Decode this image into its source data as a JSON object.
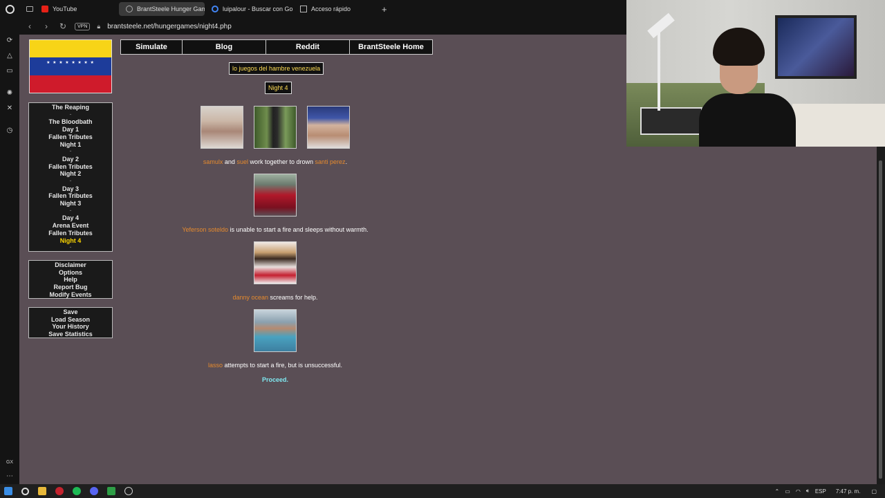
{
  "browser": {
    "tabs": [
      {
        "label": "YouTube",
        "icon": "youtube-icon"
      },
      {
        "label": "BrantSteele Hunger Gam",
        "icon": "site-icon"
      },
      {
        "label": "luipalour - Buscar con Go",
        "icon": "google-icon"
      },
      {
        "label": "Acceso rápido",
        "icon": "speed-dial-icon"
      }
    ],
    "vpn_label": "VPN",
    "url": "brantsteele.net/hungergames/night4.php"
  },
  "nav": [
    "Simulate",
    "Blog",
    "Reddit",
    "BrantSteele Home"
  ],
  "sidebar": {
    "progress": [
      {
        "label": "The Reaping"
      },
      {
        "label": "-"
      },
      {
        "label": "The Bloodbath"
      },
      {
        "label": "Day 1"
      },
      {
        "label": "Fallen Tributes"
      },
      {
        "label": "Night 1"
      },
      {
        "label": "-"
      },
      {
        "label": "Day 2"
      },
      {
        "label": "Fallen Tributes"
      },
      {
        "label": "Night 2"
      },
      {
        "label": "-"
      },
      {
        "label": "Day 3"
      },
      {
        "label": "Fallen Tributes"
      },
      {
        "label": "Night 3"
      },
      {
        "label": "-"
      },
      {
        "label": "Day 4"
      },
      {
        "label": "Arena Event"
      },
      {
        "label": "Fallen Tributes"
      },
      {
        "label": "Night 4",
        "current": true
      },
      {
        "label": "-"
      }
    ],
    "tools": [
      "Disclaimer",
      "Options",
      "Help",
      "Report Bug",
      "Modify Events"
    ],
    "save": [
      "Save",
      "Load Season",
      "Your History",
      "Save Statistics"
    ]
  },
  "season_title": "lo juegos del hambre venezuela",
  "phase_title": "Night 4",
  "events": [
    {
      "parts": [
        {
          "t": "samulx",
          "n": true
        },
        {
          "t": " and "
        },
        {
          "t": "suel",
          "n": true
        },
        {
          "t": " work together to drown "
        },
        {
          "t": "santi perez",
          "n": true
        },
        {
          "t": "."
        }
      ]
    },
    {
      "parts": [
        {
          "t": "Yeferson soteldo",
          "n": true
        },
        {
          "t": " is unable to start a fire and sleeps without warmth."
        }
      ]
    },
    {
      "parts": [
        {
          "t": "danny ocean",
          "n": true
        },
        {
          "t": " screams for help."
        }
      ]
    },
    {
      "parts": [
        {
          "t": "lasso",
          "n": true
        },
        {
          "t": " attempts to start a fire, but is unsuccessful."
        }
      ]
    }
  ],
  "proceed_label": "Proceed.",
  "taskbar": {
    "language": "ESP",
    "time": "7:47 p. m."
  },
  "colors": {
    "page_bg": "#5a4e55",
    "tribute_name": "#e58a2e",
    "current_phase": "#ffd700",
    "proceed": "#7fe8f0"
  }
}
